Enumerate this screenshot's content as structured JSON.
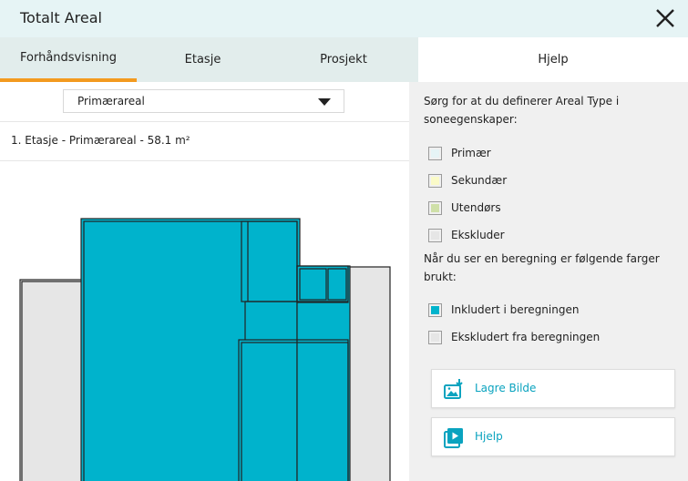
{
  "window": {
    "title": "Totalt Areal"
  },
  "tabs": [
    {
      "label": "Forhåndsvisning",
      "active": true
    },
    {
      "label": "Etasje",
      "active": false
    },
    {
      "label": "Prosjekt",
      "active": false
    }
  ],
  "help_tab": {
    "label": "Hjelp"
  },
  "area_select": {
    "value": "Primærareal"
  },
  "summary": "1. Etasje - Primærareal - 58.1 m²",
  "help": {
    "intro": "Sørg for at du definerer Areal Type i soneegenskaper:",
    "area_types": [
      {
        "label": "Primær",
        "color": "#e6f4f6"
      },
      {
        "label": "Sekundær",
        "color": "#fafac8"
      },
      {
        "label": "Utendørs",
        "color": "#cfe0a8"
      },
      {
        "label": "Ekskluder",
        "color": "#e6e6e6"
      }
    ],
    "calc_intro": "Når du ser en beregning er følgende farger brukt:",
    "calc_colors": [
      {
        "label": "Inkludert i beregningen",
        "color": "#00b3cc"
      },
      {
        "label": "Ekskludert fra beregningen",
        "color": "#e6e6e6"
      }
    ]
  },
  "actions": {
    "save_image": {
      "label": "Lagre Bilde",
      "icon": "image-save-icon"
    },
    "help": {
      "label": "Hjelp",
      "icon": "video-play-icon"
    }
  },
  "colors": {
    "accent": "#f39a1f",
    "included": "#00b3cc",
    "excluded": "#e6e6e6",
    "link": "#0aa3bf"
  }
}
